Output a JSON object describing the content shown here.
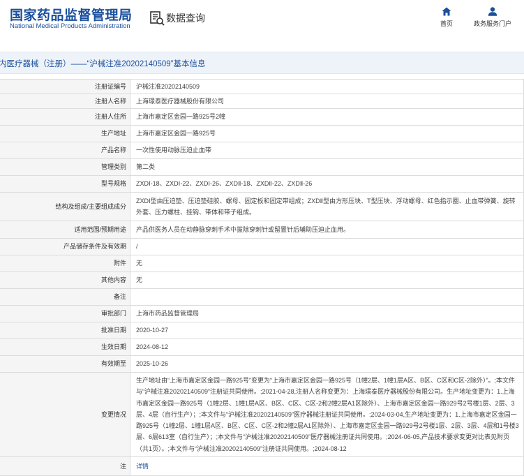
{
  "header": {
    "logo_cn": "国家药品监督管理局",
    "logo_en": "National Medical Products Administration",
    "query_title": "数据查询",
    "nav_home_label": "首页",
    "nav_service_label": "政务服务门户",
    "brand_color": "#1b4f9c"
  },
  "page_title": "内医疗器械（注册）——“沪械注准20202140509”基本信息",
  "rows": [
    {
      "label": "注册证编号",
      "value": "沪械注准20202140509"
    },
    {
      "label": "注册人名称",
      "value": "上海璟泰医疗器械股份有限公司"
    },
    {
      "label": "注册人住所",
      "value": "上海市嘉定区金园一路925号2幢"
    },
    {
      "label": "生产地址",
      "value": "上海市嘉定区金园一路925号"
    },
    {
      "label": "产品名称",
      "value": "一次性使用动脉压迫止血带"
    },
    {
      "label": "管理类别",
      "value": "第二类"
    },
    {
      "label": "型号规格",
      "value": "ZXDⅠ-18、ZXDⅠ-22、ZXDⅠ-26、ZXDⅡ-18、ZXDⅡ-22、ZXDⅡ-26"
    },
    {
      "label": "结构及组成/主要组成成分",
      "value": "ZXDⅠ型由压迫垫、压迫垫硅胶、螺母、固定板和固定带组成；ZXDⅡ型由方形压块、T型压块、浮动螺母、红色指示圈、止血带弹簧、旋转外套、压力螺柱、挂钩、带体和带子组成。"
    },
    {
      "label": "适用范围/预期用途",
      "value": "产品供医务人员在动静脉穿刺手术中拔除穿刺针或留置针后辅助压迫止血用。"
    },
    {
      "label": "产品储存条件及有效期",
      "value": "/"
    },
    {
      "label": "附件",
      "value": "无"
    },
    {
      "label": "其他内容",
      "value": "无"
    },
    {
      "label": "备注",
      "value": ""
    },
    {
      "label": "审批部门",
      "value": "上海市药品监督管理局"
    },
    {
      "label": "批准日期",
      "value": "2020-10-27"
    },
    {
      "label": "生效日期",
      "value": "2024-08-12"
    },
    {
      "label": "有效期至",
      "value": "2025-10-26"
    },
    {
      "label": "变更情况",
      "value": "生产地址由“上海市嘉定区金园一路925号”变更为“上海市嘉定区金园一路925号（1幢2层、1幢1层A区、B区、C区和C区-2除外）”。;本文件与“沪械注准20202140509”注册证共同使用。;2021-04-28,注册人名称变更为：上海璟泰医疗器械股份有限公司。生产地址变更为：1.上海市嘉定区金园一路925号（1幢2层、1幢1层A区、B区、C区、C区-2和2幢2层A1区除外）、上海市嘉定区金园一路929号2号楼1层、2层、3层、4层（自行生产）；;本文件与“沪械注准20202140509”医疗器械注册证共同使用。;2024-03-04,生产地址变更为：1.上海市嘉定区金园一路925号（1幢2层、1幢1层A区、B区、C区、C区-2和2幢2层A1区除外）、上海市嘉定区金园一路929号2号楼1层、2层、3层、4层和1号楼3层、6层613室（自行生产）；;本文件与“沪械注准20202140509”医疗器械注册证共同使用。;2024-06-05,产品技术要求变更对比表见附页（共1页）。;本文件与“沪械注准20202140509”注册证共同使用。;2024-08-12"
    },
    {
      "label": "注",
      "value": "详情"
    }
  ]
}
